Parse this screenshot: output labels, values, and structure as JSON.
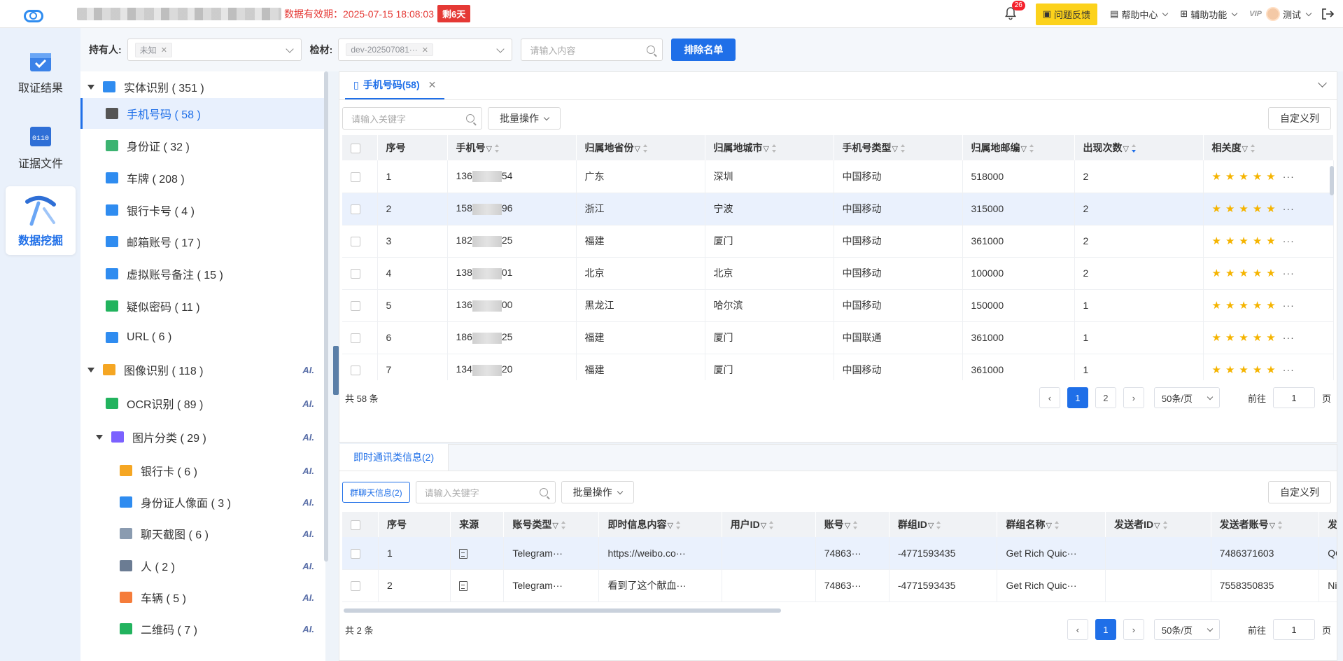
{
  "topbar": {
    "expiry_text": "数据有效期：2025-07-15 18:08:03",
    "remaining": "剩6天",
    "notification_count": "26",
    "feedback": "问题反馈",
    "help_center": "帮助中心",
    "assist": "辅助功能",
    "vip": "VIP",
    "user": "测试"
  },
  "leftnav": {
    "items": [
      {
        "label": "取证结果",
        "icon": "calendar-check-icon"
      },
      {
        "label": "证据文件",
        "icon": "binary-file-icon"
      },
      {
        "label": "数据挖掘",
        "icon": "pickaxe-icon",
        "active": true
      }
    ]
  },
  "filters": {
    "holder_label": "持有人:",
    "holder_tag": "未知",
    "material_label": "检材:",
    "material_tag": "dev-202507081···",
    "search_placeholder": "请输入内容",
    "exclude_button": "排除名单"
  },
  "tree": {
    "nodes": [
      {
        "label": "实体识别 ( 351 )",
        "level": 0,
        "expand": true,
        "icon": "layers-icon",
        "color": "#2f8cf0"
      },
      {
        "label": "手机号码 ( 58 )",
        "level": 1,
        "icon": "phone-icon",
        "color": "#555555",
        "selected": true
      },
      {
        "label": "身份证 ( 32 )",
        "level": 1,
        "icon": "id-card-icon",
        "color": "#3cb371"
      },
      {
        "label": "车牌 ( 208 )",
        "level": 1,
        "icon": "license-plate-icon",
        "color": "#2f8cf0"
      },
      {
        "label": "银行卡号 ( 4 )",
        "level": 1,
        "icon": "bank-card-icon",
        "color": "#2f8cf0"
      },
      {
        "label": "邮箱账号 ( 17 )",
        "level": 1,
        "icon": "email-icon",
        "color": "#2f8cf0"
      },
      {
        "label": "虚拟账号备注 ( 15 )",
        "level": 1,
        "icon": "account-note-icon",
        "color": "#2f8cf0"
      },
      {
        "label": "疑似密码 ( 11 )",
        "level": 1,
        "icon": "lock-icon",
        "color": "#22b35e"
      },
      {
        "label": "URL ( 6 )",
        "level": 1,
        "icon": "globe-icon",
        "color": "#2f8cf0"
      },
      {
        "label": "图像识别 ( 118 )",
        "level": 0,
        "expand": true,
        "icon": "image-icon",
        "color": "#f5a623",
        "ai": true
      },
      {
        "label": "OCR识别 ( 89 )",
        "level": 1,
        "icon": "ocr-icon",
        "color": "#22b35e",
        "ai": true
      },
      {
        "label": "图片分类 ( 29 )",
        "level": 1,
        "expand": true,
        "icon": "photo-category-icon",
        "color": "#7b61ff",
        "ai": true
      },
      {
        "label": "银行卡 ( 6 )",
        "level": 2,
        "icon": "wallet-icon",
        "color": "#f5a623",
        "ai": true
      },
      {
        "label": "身份证人像面 ( 3 )",
        "level": 2,
        "icon": "face-scan-icon",
        "color": "#2f8cf0",
        "ai": true
      },
      {
        "label": "聊天截图 ( 6 )",
        "level": 2,
        "icon": "chat-screenshot-icon",
        "color": "#8a9bb0",
        "ai": true
      },
      {
        "label": "人 ( 2 )",
        "level": 2,
        "icon": "person-icon",
        "color": "#6b7c93",
        "ai": true
      },
      {
        "label": "车辆 ( 5 )",
        "level": 2,
        "icon": "car-icon",
        "color": "#f57c3a",
        "ai": true
      },
      {
        "label": "二维码 ( 7 )",
        "level": 2,
        "icon": "qr-code-icon",
        "color": "#22b35e",
        "ai": true
      }
    ],
    "ai_label": "AI."
  },
  "top_panel": {
    "tab_label": "手机号码(58)",
    "search_placeholder": "请输入关键字",
    "batch": "批量操作",
    "custom_cols": "自定义列",
    "columns": [
      "序号",
      "手机号",
      "归属地省份",
      "归属地城市",
      "手机号类型",
      "归属地邮编",
      "出现次数",
      "相关度"
    ],
    "rows": [
      {
        "no": "1",
        "pre": "136",
        "post": "54",
        "prov": "广东",
        "city": "深圳",
        "type": "中国移动",
        "zip": "518000",
        "count": "2"
      },
      {
        "no": "2",
        "pre": "158",
        "post": "96",
        "prov": "浙江",
        "city": "宁波",
        "type": "中国移动",
        "zip": "315000",
        "count": "2"
      },
      {
        "no": "3",
        "pre": "182",
        "post": "25",
        "prov": "福建",
        "city": "厦门",
        "type": "中国移动",
        "zip": "361000",
        "count": "2"
      },
      {
        "no": "4",
        "pre": "138",
        "post": "01",
        "prov": "北京",
        "city": "北京",
        "type": "中国移动",
        "zip": "100000",
        "count": "2"
      },
      {
        "no": "5",
        "pre": "136",
        "post": "00",
        "prov": "黑龙江",
        "city": "哈尔滨",
        "type": "中国移动",
        "zip": "150000",
        "count": "1"
      },
      {
        "no": "6",
        "pre": "186",
        "post": "25",
        "prov": "福建",
        "city": "厦门",
        "type": "中国联通",
        "zip": "361000",
        "count": "1"
      },
      {
        "no": "7",
        "pre": "134",
        "post": "20",
        "prov": "福建",
        "city": "厦门",
        "type": "中国移动",
        "zip": "361000",
        "count": "1"
      }
    ],
    "stars": "★★★★★",
    "total": "共 58 条",
    "pages": [
      "1",
      "2"
    ],
    "page_size": "50条/页",
    "goto": "前往",
    "goto_value": "1",
    "page_unit": "页"
  },
  "bottom_panel": {
    "tab_label": "即时通讯类信息(2)",
    "group_btn": "群聊天信息(2)",
    "search_placeholder": "请输入关键字",
    "batch": "批量操作",
    "custom_cols": "自定义列",
    "columns": [
      "序号",
      "来源",
      "账号类型",
      "即时信息内容",
      "用户ID",
      "账号",
      "群组ID",
      "群组名称",
      "发送者ID",
      "发送者账号",
      "发送者昵"
    ],
    "rows": [
      {
        "no": "1",
        "acct_type": "Telegram···",
        "content": "https://weibo.co···",
        "uid": "",
        "acct": "74863···",
        "gid": "-4771593435",
        "gname": "Get Rich Quic···",
        "sid": "",
        "saccount": "7486371603",
        "snick": "QQ aa"
      },
      {
        "no": "2",
        "acct_type": "Telegram···",
        "content": "看到了这个献血···",
        "uid": "",
        "acct": "74863···",
        "gid": "-4771593435",
        "gname": "Get Rich Quic···",
        "sid": "",
        "saccount": "7558350835",
        "snick": "Nichola"
      }
    ],
    "total": "共 2 条",
    "pages": [
      "1"
    ],
    "page_size": "50条/页",
    "goto": "前往",
    "goto_value": "1",
    "page_unit": "页"
  }
}
